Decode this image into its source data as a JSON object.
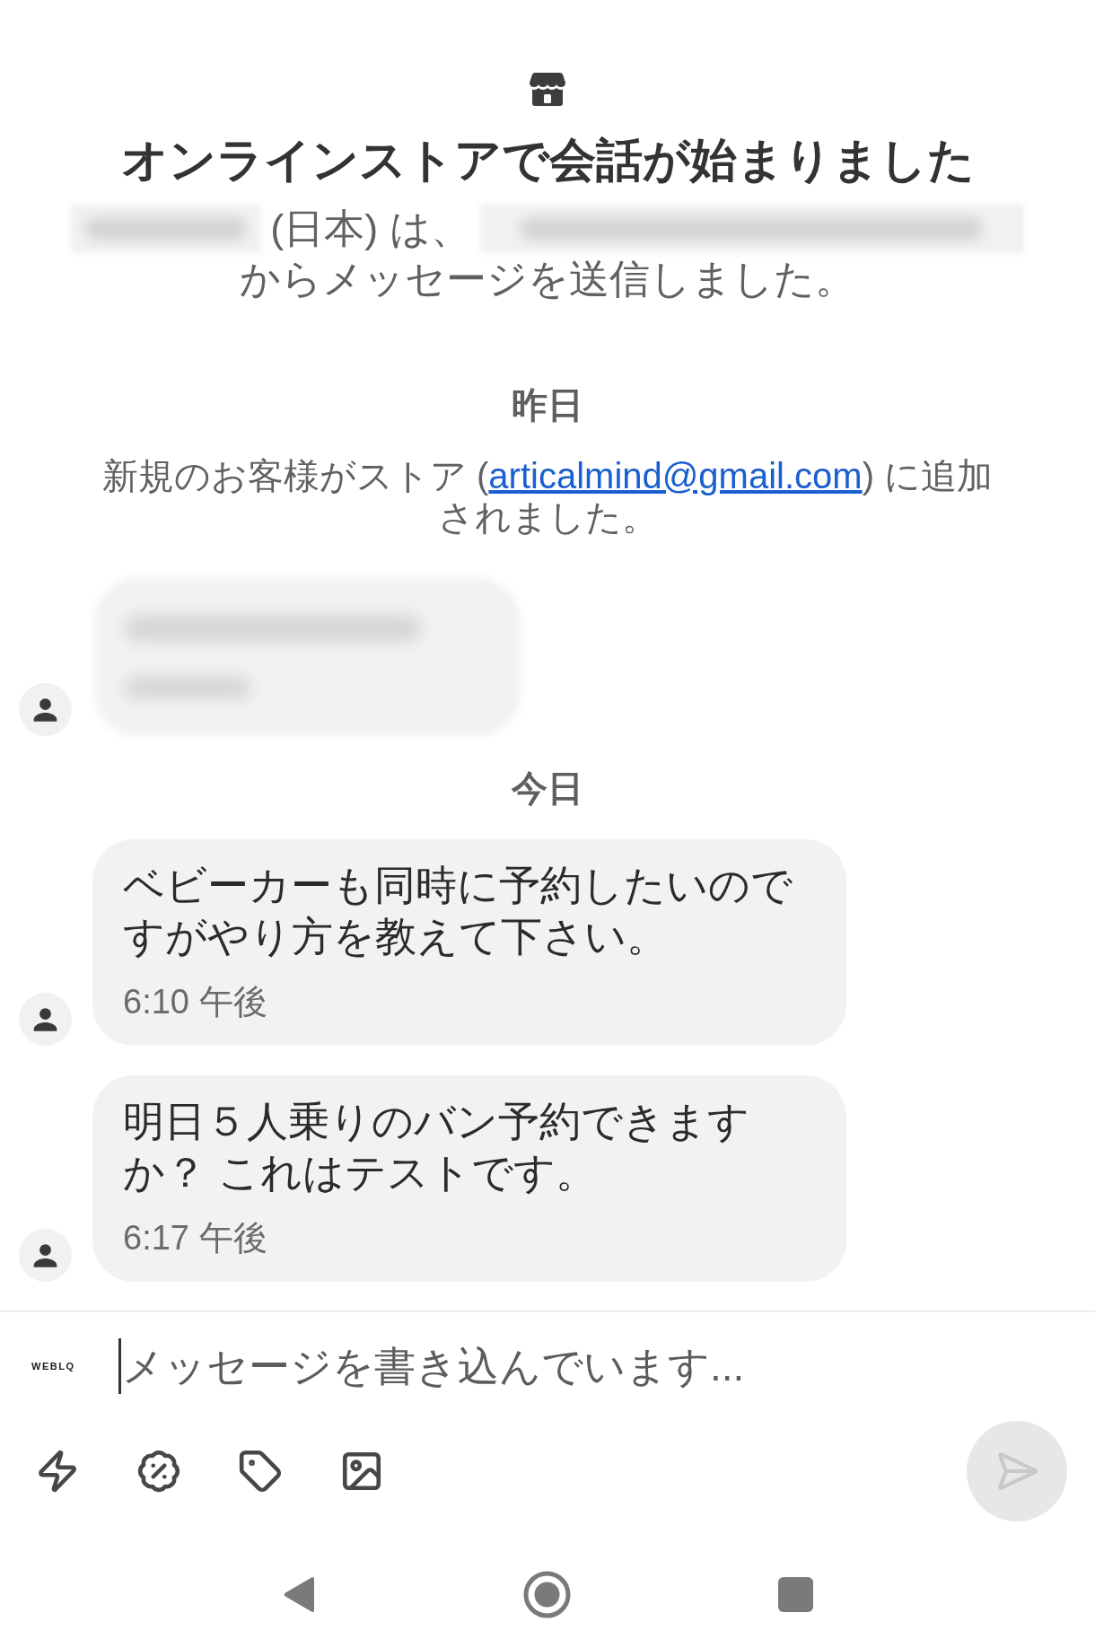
{
  "header": {
    "title": "オンラインストアで会話が始まりました",
    "subtitle_line_1": [
      {
        "kind": "blurred"
      },
      {
        "kind": "text",
        "text": "(日本) は、"
      },
      {
        "kind": "blurred"
      }
    ],
    "subtitle_line_2": "からメッセージを送信しました。"
  },
  "sections": [
    {
      "date": "昨日",
      "items": [
        {
          "kind": "system",
          "text_before": "新規のお客様がストア (",
          "link": "articalmind@gmail.com",
          "text_after": ") に追加されました。"
        },
        {
          "kind": "blurred_message"
        }
      ]
    },
    {
      "date": "今日",
      "items": [
        {
          "kind": "message",
          "text": "ベビーカーも同時に予約したいのですがやり方を教えて下さい。",
          "time": "6:10 午後"
        },
        {
          "kind": "message",
          "text": "明日５人乗りのバン予約できますか？ これはテストです。",
          "time": "6:17 午後"
        }
      ]
    }
  ],
  "composer": {
    "logo": "WEBLQ",
    "placeholder": "メッセージを書き込んでいます...",
    "send_button": {
      "disabled": true
    }
  }
}
